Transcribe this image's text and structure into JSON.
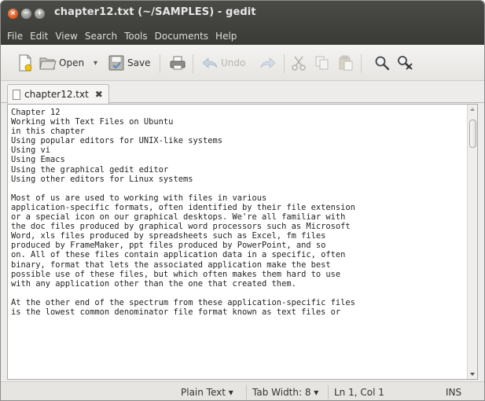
{
  "window": {
    "title": "chapter12.txt (~/SAMPLES) - gedit"
  },
  "menubar": {
    "items": [
      "File",
      "Edit",
      "View",
      "Search",
      "Tools",
      "Documents",
      "Help"
    ]
  },
  "toolbar": {
    "open_label": "Open",
    "open_dropdown": "▾",
    "save_label": "Save",
    "undo_label": "Undo"
  },
  "tab": {
    "label": "chapter12.txt",
    "close": "✖"
  },
  "document": {
    "lines": [
      "Chapter 12",
      "Working with Text Files on Ubuntu",
      "in this chapter",
      "Using popular editors for UNIX-like systems",
      "Using vi",
      "Using Emacs",
      "Using the graphical gedit editor",
      "Using other editors for Linux systems",
      "",
      "Most of us are used to working with files in various",
      "application-specific formats, often identified by their file extension",
      "or a special icon on our graphical desktops. We're all familiar with",
      "the doc files produced by graphical word processors such as Microsoft",
      "Word, xls files produced by spreadsheets such as Excel, fm files",
      "produced by FrameMaker, ppt files produced by PowerPoint, and so",
      "on. All of these files contain application data in a specific, often",
      "binary, format that lets the associated application make the best",
      "possible use of these files, but which often makes them hard to use",
      "with any application other than the one that created them.",
      "",
      "At the other end of the spectrum from these application-specific files",
      "is the lowest common denominator file format known as text files or"
    ]
  },
  "statusbar": {
    "language": "Plain Text ▾",
    "tab_width": "Tab Width: 8 ▾",
    "position": "Ln 1, Col 1",
    "mode": "INS"
  },
  "icons": {
    "new": "new-document-icon",
    "open": "open-folder-icon",
    "save": "save-icon",
    "print": "print-icon",
    "undo": "undo-icon",
    "redo": "redo-icon",
    "cut": "cut-icon",
    "copy": "copy-icon",
    "paste": "paste-icon",
    "find": "find-icon",
    "replace": "find-replace-icon"
  },
  "colors": {
    "titlebar": "#3f3f3b",
    "close_button": "#e0652e",
    "editor_bg": "#ffffff"
  }
}
